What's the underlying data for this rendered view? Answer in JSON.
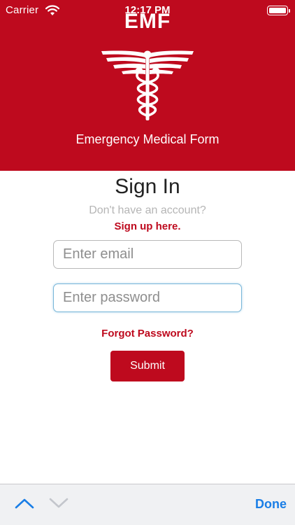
{
  "status_bar": {
    "carrier": "Carrier",
    "time": "12:17 PM"
  },
  "header": {
    "app_title": "EMF",
    "logo_icon": "caduceus-icon",
    "subtitle": "Emergency Medical Form",
    "background_color": "#be0a1e"
  },
  "signin": {
    "title": "Sign In",
    "no_account_text": "Don't have an account?",
    "signup_link": "Sign up here.",
    "email": {
      "value": "",
      "placeholder": "Enter email"
    },
    "password": {
      "value": "",
      "placeholder": "Enter password"
    },
    "forgot_link": "Forgot Password?",
    "submit_label": "Submit"
  },
  "keyboard_toolbar": {
    "previous_icon": "chevron-up-icon",
    "next_icon": "chevron-down-icon",
    "done_label": "Done",
    "accent_color": "#1a7ee6"
  }
}
